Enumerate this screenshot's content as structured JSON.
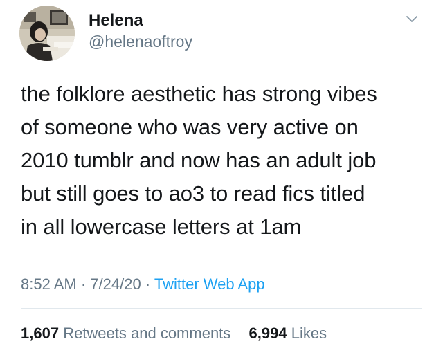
{
  "author": {
    "name": "Helena",
    "handle": "@helenaoftroy",
    "avatar_icon": "profile-photo"
  },
  "tweet": {
    "lines": [
      "the folklore aesthetic has strong vibes",
      "of someone who was very active on",
      "2010 tumblr and now has an adult job",
      "but still goes to ao3 to read fics titled",
      "in all lowercase letters at 1am"
    ]
  },
  "meta": {
    "time": "8:52 AM",
    "separator": "·",
    "date": "7/24/20",
    "app": "Twitter Web App"
  },
  "stats": {
    "retweets_count": "1,607",
    "retweets_label": "Retweets and comments",
    "likes_count": "6,994",
    "likes_label": "Likes"
  },
  "colors": {
    "link": "#1da1f2",
    "secondary_text": "#657786",
    "primary_text": "#14171a",
    "divider": "#e1e8ed"
  },
  "icons": {
    "more": "chevron-down-icon"
  }
}
